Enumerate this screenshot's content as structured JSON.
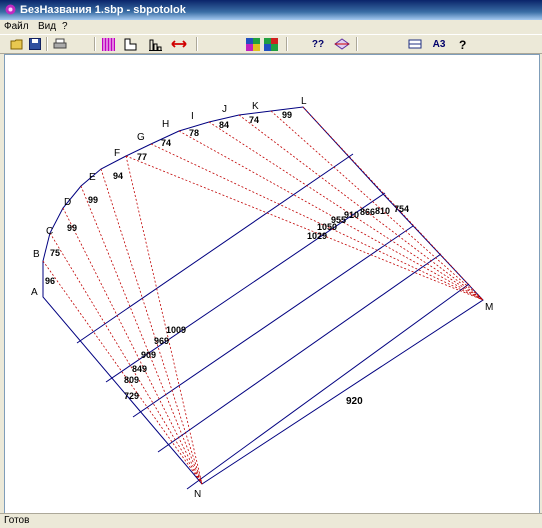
{
  "window": {
    "title": "БезНазвания 1.sbp - sbpotolok"
  },
  "menu": {
    "file": "Файл",
    "view": "Вид",
    "help": "?"
  },
  "toolbar": {
    "help_label": "??",
    "a3_label": "A3",
    "question_label": "?"
  },
  "status": {
    "text": "Готов"
  },
  "drawing": {
    "vertices": {
      "A": "A",
      "B": "B",
      "C": "C",
      "D": "D",
      "E": "E",
      "F": "F",
      "G": "G",
      "H": "H",
      "I": "I",
      "J": "J",
      "K": "K",
      "L": "L",
      "M": "M",
      "N": "N"
    },
    "edge_values": {
      "AB": "96",
      "BC": "75",
      "CD": "99",
      "DE": "99",
      "EF": "94",
      "FG": "77",
      "GH": "74",
      "HI": "78",
      "IJ": "84",
      "JK": "74",
      "KL": "99"
    },
    "diag_N": [
      "1009",
      "969",
      "909",
      "849",
      "809",
      "729"
    ],
    "diag_M": [
      "1029",
      "1050",
      "955",
      "910",
      "866",
      "810",
      "754"
    ],
    "base_length": "920"
  }
}
